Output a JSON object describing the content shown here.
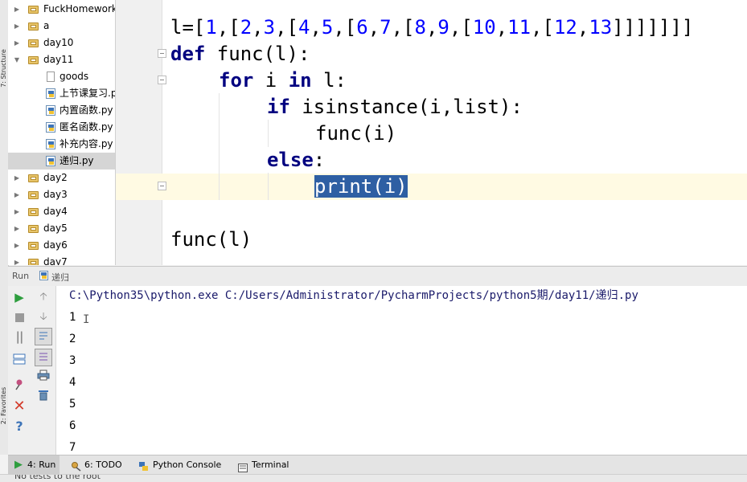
{
  "left_strip": {
    "structure_label": "7: Structure",
    "favorites_label": "2: Favorites"
  },
  "project_tree": {
    "items": [
      {
        "label": "FuckHomework",
        "type": "folder",
        "expanded": false
      },
      {
        "label": "a",
        "type": "folder",
        "expanded": false
      },
      {
        "label": "day10",
        "type": "folder",
        "expanded": false
      },
      {
        "label": "day11",
        "type": "folder",
        "expanded": true
      },
      {
        "label": "goods",
        "type": "file"
      },
      {
        "label": "上节课复习.py",
        "type": "python"
      },
      {
        "label": "内置函数.py",
        "type": "python"
      },
      {
        "label": "匿名函数.py",
        "type": "python"
      },
      {
        "label": "补充内容.py",
        "type": "python"
      },
      {
        "label": "递归.py",
        "type": "python",
        "selected": true
      },
      {
        "label": "day2",
        "type": "folder",
        "expanded": false
      },
      {
        "label": "day3",
        "type": "folder",
        "expanded": false
      },
      {
        "label": "day4",
        "type": "folder",
        "expanded": false
      },
      {
        "label": "day5",
        "type": "folder",
        "expanded": false
      },
      {
        "label": "day6",
        "type": "folder",
        "expanded": false
      },
      {
        "label": "day7",
        "type": "folder",
        "expanded": false
      }
    ]
  },
  "editor": {
    "line1": {
      "var": "l=[",
      "n1": "1",
      "n2": "2",
      "n3": "3",
      "n4": "4",
      "n5": "5",
      "n6": "6",
      "n7": "7",
      "n8": "8",
      "n9": "9",
      "n10": "10",
      "n11": "11",
      "n12": "12",
      "n13": "13",
      "close": "]]]]]]]"
    },
    "line2": {
      "kw": "def",
      "rest": " func(l):"
    },
    "line3": {
      "kw1": "for",
      "mid": " i ",
      "kw2": "in",
      "rest": " l:"
    },
    "line4": {
      "kw": "if",
      "rest": " isinstance(i,list):"
    },
    "line5": {
      "text": "func(i)"
    },
    "line6": {
      "kw": "else",
      "rest": ":"
    },
    "line7": {
      "selected": "print(i)"
    },
    "line9": {
      "text": "func(l)"
    }
  },
  "run_panel": {
    "title": "Run",
    "config_name": "递归",
    "command": "C:\\Python35\\python.exe C:/Users/Administrator/PycharmProjects/python5期/day11/递归.py",
    "output": [
      "1",
      "2",
      "3",
      "4",
      "5",
      "6",
      "7"
    ]
  },
  "bottom_tabs": [
    {
      "label": "4: Run",
      "icon": "run-icon",
      "active": true
    },
    {
      "label": "6: TODO",
      "icon": "todo-icon",
      "active": false
    },
    {
      "label": "Python Console",
      "icon": "python-console-icon",
      "active": false
    },
    {
      "label": "Terminal",
      "icon": "terminal-icon",
      "active": false
    }
  ],
  "status_bar": {
    "text": "No tests to the root"
  },
  "colors": {
    "keyword": "#000080",
    "number": "#0000ff",
    "selection": "#2e5fa3",
    "current_line": "#fffae3",
    "run_green": "#2e9e3e",
    "stop_red": "#d33b2a"
  }
}
